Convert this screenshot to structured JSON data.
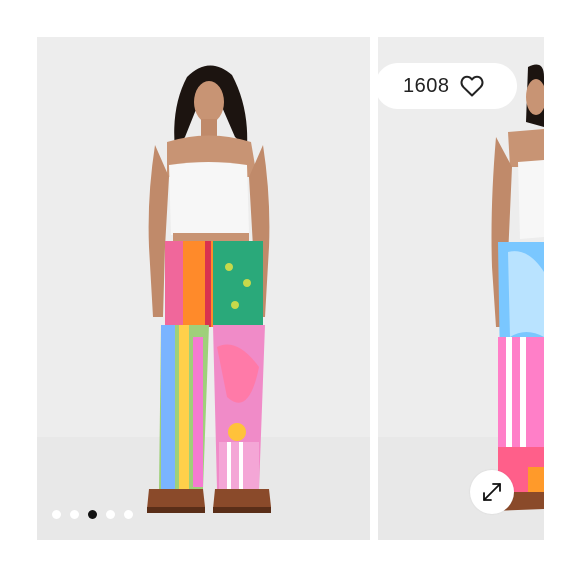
{
  "gallery": {
    "likes": {
      "count": "1608",
      "icon": "heart-outline-icon"
    },
    "carousel": {
      "dot_count": 5,
      "active_index": 2
    },
    "expand_icon": "expand-arrows-icon",
    "colors": {
      "background": "#ededed",
      "pill": "#ffffff",
      "active_dot": "#111111",
      "inactive_dot": "#ffffff"
    }
  }
}
